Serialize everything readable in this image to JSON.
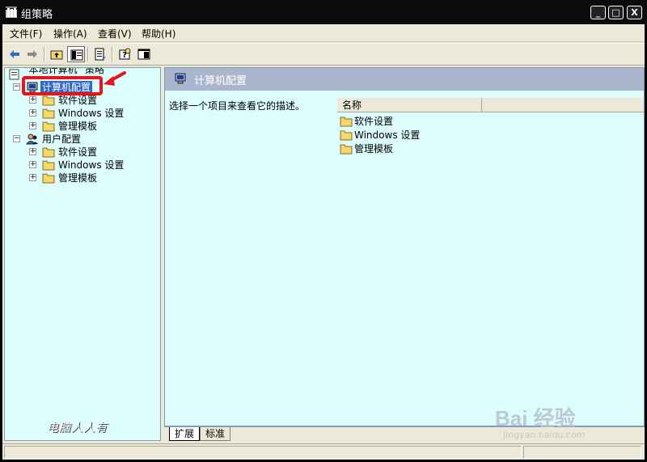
{
  "window": {
    "title": "组策略",
    "buttons": {
      "minimize": "_",
      "maximize": "□",
      "close": "X"
    }
  },
  "menubar": {
    "items": [
      {
        "label": "文件(F)"
      },
      {
        "label": "操作(A)"
      },
      {
        "label": "查看(V)"
      },
      {
        "label": "帮助(H)"
      }
    ]
  },
  "toolbar": {
    "buttons": [
      "back-arrow-icon",
      "forward-arrow-icon",
      "up-folder-icon",
      "show-hide-tree-icon",
      "export-list-icon",
      "help-icon",
      "console-window-icon"
    ]
  },
  "tree": {
    "root": "\"本地计算机\" 策略",
    "computer_config": "计算机配置",
    "user_config": "用户配置",
    "computer_children": [
      "软件设置",
      "Windows 设置",
      "管理模板"
    ],
    "user_children": [
      "软件设置",
      "Windows 设置",
      "管理模板"
    ]
  },
  "right_pane": {
    "header": "计算机配置",
    "description": "选择一个项目来查看它的描述。",
    "column_name": "名称",
    "items": [
      "软件设置",
      "Windows 设置",
      "管理模板"
    ]
  },
  "tabs": {
    "extended": "扩展",
    "standard": "标准"
  },
  "overlays": {
    "signature": "电脑人人有",
    "watermark_main": "Bai 经验",
    "watermark_sub": "jingyan.baidu.com"
  },
  "colors": {
    "pane_bg": "#ddfdfd",
    "selection": "#316ac5",
    "header_band": "#a9b6ce",
    "annotation_red": "#e8141c",
    "folder_yellow": "#f5d76e"
  }
}
